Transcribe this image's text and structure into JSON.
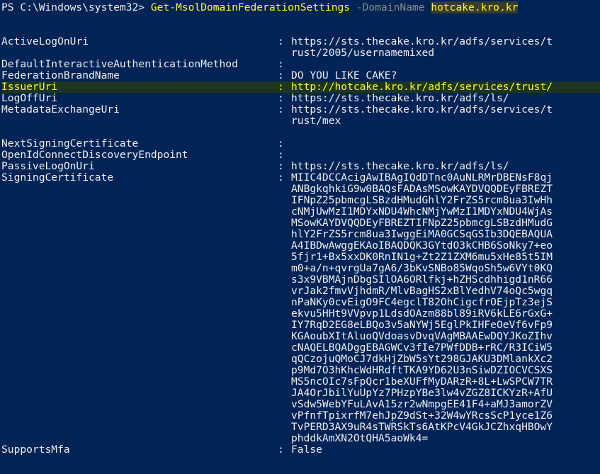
{
  "prompt": {
    "path": "PS C:\\Windows\\system32>",
    "cmdlet": "Get-MsolDomainFederationSettings",
    "parameter": "-DomainName",
    "argument": "hotcake.kro.kr"
  },
  "separator": ":",
  "properties": [
    {
      "key": "ActiveLogOnUri",
      "value_lines": [
        "https://sts.thecake.kro.kr/adfs/services/t",
        "rust/2005/usernamemixed"
      ]
    },
    {
      "key": "DefaultInteractiveAuthenticationMethod",
      "value_lines": [
        ""
      ]
    },
    {
      "key": "FederationBrandName",
      "value_lines": [
        "DO YOU LIKE CAKE?"
      ]
    },
    {
      "key": "IssuerUri",
      "value_lines": [
        "http://hotcake.kro.kr/adfs/services/trust/"
      ],
      "highlighted": true
    },
    {
      "key": "LogOffUri",
      "value_lines": [
        "https://sts.thecake.kro.kr/adfs/ls/"
      ]
    },
    {
      "key": "MetadataExchangeUri",
      "value_lines": [
        "https://sts.thecake.kro.kr/adfs/services/t",
        "rust/mex"
      ]
    },
    {
      "key": "NextSigningCertificate",
      "value_lines": [
        ""
      ]
    },
    {
      "key": "OpenIdConnectDiscoveryEndpoint",
      "value_lines": [
        ""
      ]
    },
    {
      "key": "PassiveLogOnUri",
      "value_lines": [
        "https://sts.thecake.kro.kr/adfs/ls/"
      ]
    },
    {
      "key": "SigningCertificate",
      "value_lines": [
        "MIIC4DCCAcigAwIBAgIQdDTnc0AuNLRMrDBENsF8qj",
        "ANBgkqhkiG9w0BAQsFADAsMSowKAYDVQQDEyFBREZT",
        "IFNpZ25pbmcgLSBzdHMudGhlY2FrZS5rcm8ua3IwHh",
        "cNMjUwMzI1MDYxNDU4WhcNMjYwMzI1MDYxNDU4WjAs",
        "MSowKAYDVQQDEyFBREZTIFNpZ25pbmcgLSBzdHMudG",
        "hlY2FrZS5rcm8ua3IwggEiMA0GCSqGSIb3DQEBAQUA",
        "A4IBDwAwggEKAoIBAQDQK3GYtdO3kCHB6SoNky7+eo",
        "5fjr1+Bx5xxDK0RnIN1g+Zt2Z1ZXM6mu5xHe85t5IM",
        "m0+a/n+qvrgUa7gA6/3bKvSNBo85WqoSh5w6VYt0KQ",
        "s3x9VBMAjnDbgSIlOA6ORlfkj+hZHScdhhigd1nR66",
        "vrJak2fmvVjhdmR/MlvBagHS2xBlYedhV74oQc5wgq",
        "nPaNKy0cvEigO9FC4egclT82OhCigcfrOEjpTz3ejS",
        "ekvu5HHt9VVpvp1LdsdOAzm88bl89iRV6kLE6rGxG+",
        "IY7RqD2EG8eLBQo3v5aNYWj5EglPkIHFeOeVf6vFp9",
        "KGAoubXItAluoQVdoasvDvqVAgMBAAEwDQYJKoZIhv",
        "cNAQELBQADggEBAGWCv3fIe7PWfDDB+rRC/R3ICiW5",
        "qQCzojuQMoCJ7dkHjZbW5sYt298GJAKU3DMlankXc2",
        "p9Md7O3hKhcWdHRdftTKA9YD62U3nSiwDZIOCVCSXS",
        "MS5ncOIc7sFpQcr1beXUFfMyDARzR+8L+LwSPCW7TR",
        "JA4OrJbilYuUpYz7PHzpYBe3lw4vZGZ8ICKYzR+AfU",
        "vSdw5WebYFuLAvA15zr2wNmpgEE41F4+aMJ3amorZV",
        "vPfnfTpixrfM7ehJpZ9dSt+32W4wYRcsScP1yce1Z6",
        "TvPERD3AX9uR4sTWRSkTs6AtKPcV4GkJCZhxqHBOwY",
        "phddkAmXN2OtQHA5aoWk4="
      ]
    },
    {
      "key": "SupportsMfa",
      "value_lines": [
        "False"
      ]
    }
  ]
}
